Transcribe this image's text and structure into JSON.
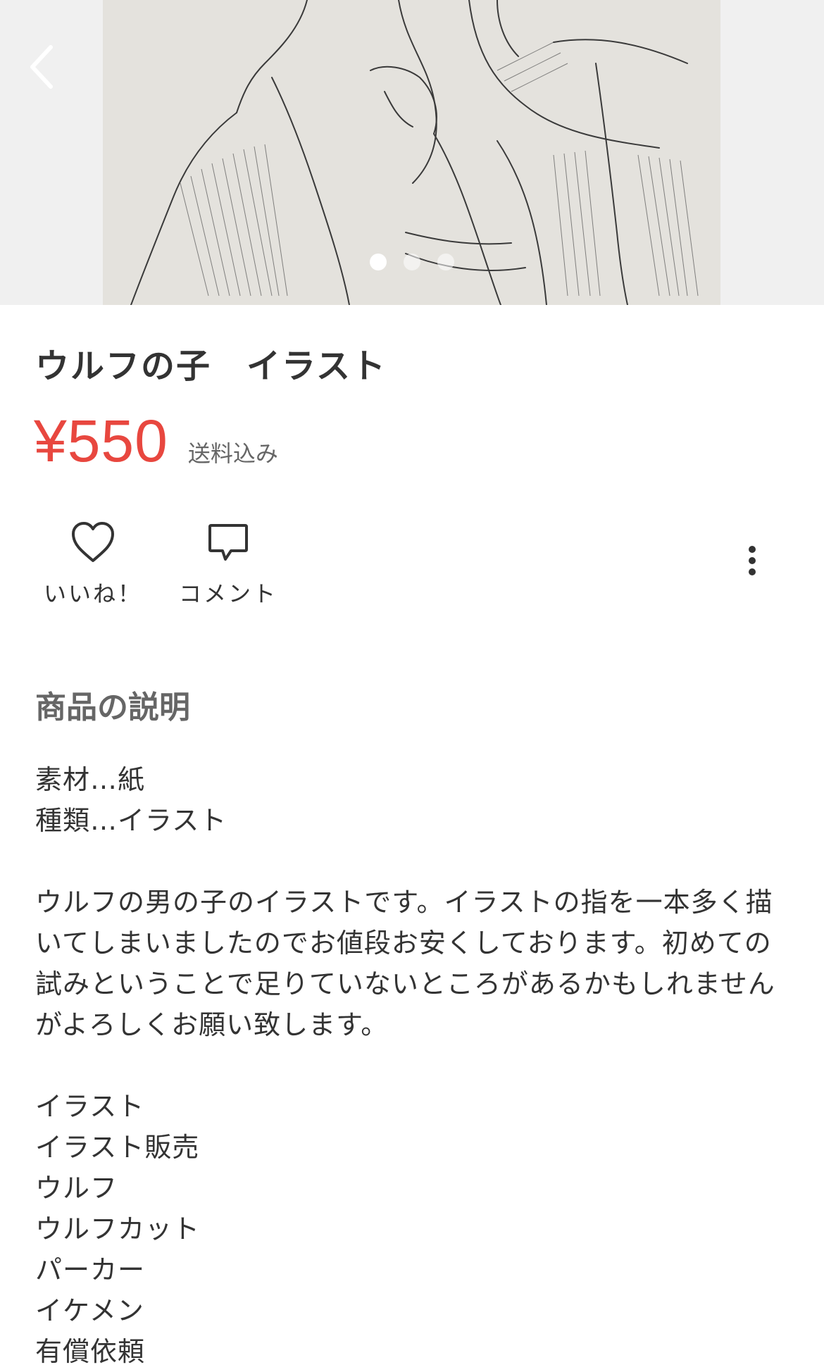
{
  "product": {
    "title": "ウルフの子　イラスト",
    "price": "¥550",
    "shipping": "送料込み"
  },
  "gallery": {
    "image_count": 3,
    "active_index": 0
  },
  "actions": {
    "like_label": "いいね！",
    "comment_label": "コメント"
  },
  "description": {
    "heading": "商品の説明",
    "body": "素材…紙\n種類…イラスト\n\nウルフの男の子のイラストです。イラストの指を一本多く描いてしまいましたのでお値段お安くしております。初めての試みということで足りていないところがあるかもしれませんがよろしくお願い致します。\n\nイラスト\nイラスト販売\nウルフ\nウルフカット\nパーカー\nイケメン\n有償依頼"
  },
  "icons": {
    "back": "chevron-left-icon",
    "like": "heart-icon",
    "comment": "speech-bubble-icon",
    "more": "more-vertical-icon"
  },
  "colors": {
    "price": "#e8473f",
    "text": "#333333",
    "muted": "#666666"
  }
}
